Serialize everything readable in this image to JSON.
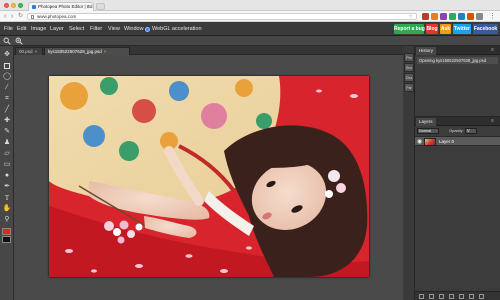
{
  "browser": {
    "tab_title": "Photopea Photo Editor | Ed",
    "tab_close": "×",
    "url": "www.photopea.com",
    "nav_back": "‹",
    "nav_forward": "›",
    "nav_reload": "↻",
    "bookmark_star": "☆",
    "menu_glyph": "⋮"
  },
  "menubar": {
    "items": [
      "File",
      "Edit",
      "Image",
      "Layer",
      "Select",
      "Filter",
      "View",
      "Window"
    ],
    "webgl_label": "WebGL acceleration",
    "buttons": [
      {
        "label": "Report a bug",
        "color": "#2fa84f"
      },
      {
        "label": "Blog",
        "color": "#e5362b"
      },
      {
        "label": "Ask",
        "color": "#f39c12"
      },
      {
        "label": "Twitter",
        "color": "#1da1f2"
      },
      {
        "label": "Facebook",
        "color": "#3b5998"
      }
    ]
  },
  "toolbox": {
    "tools": [
      "move-tool-icon",
      "marquee-tool-icon",
      "lasso-tool-icon",
      "magic-wand-tool-icon",
      "crop-tool-icon",
      "eyedropper-tool-icon",
      "healing-brush-tool-icon",
      "brush-tool-icon",
      "clone-stamp-tool-icon",
      "eraser-tool-icon",
      "gradient-tool-icon",
      "blur-tool-icon",
      "pen-tool-icon",
      "text-tool-icon",
      "hand-tool-icon",
      "zoom-tool-icon"
    ],
    "foreground_color": "#e0241f",
    "background_color": "#111111"
  },
  "documents": {
    "tabs": [
      {
        "label": "00.psd",
        "close": "×",
        "active": false
      },
      {
        "label": "kys1505225076​28_jpg.psd",
        "close": "×",
        "active": true
      }
    ]
  },
  "side_buttons": [
    "Pro",
    "Bru",
    "Cha",
    "Par"
  ],
  "history": {
    "title": "History",
    "entries": [
      "Opening kys150522507628_jpg.psd"
    ]
  },
  "layers": {
    "title": "Layers",
    "blend_mode": "Normal",
    "opacity_label": "Opacity:",
    "opacity_value": "ᐯ",
    "items": [
      {
        "name": "Layer 0",
        "visible": true
      }
    ]
  }
}
